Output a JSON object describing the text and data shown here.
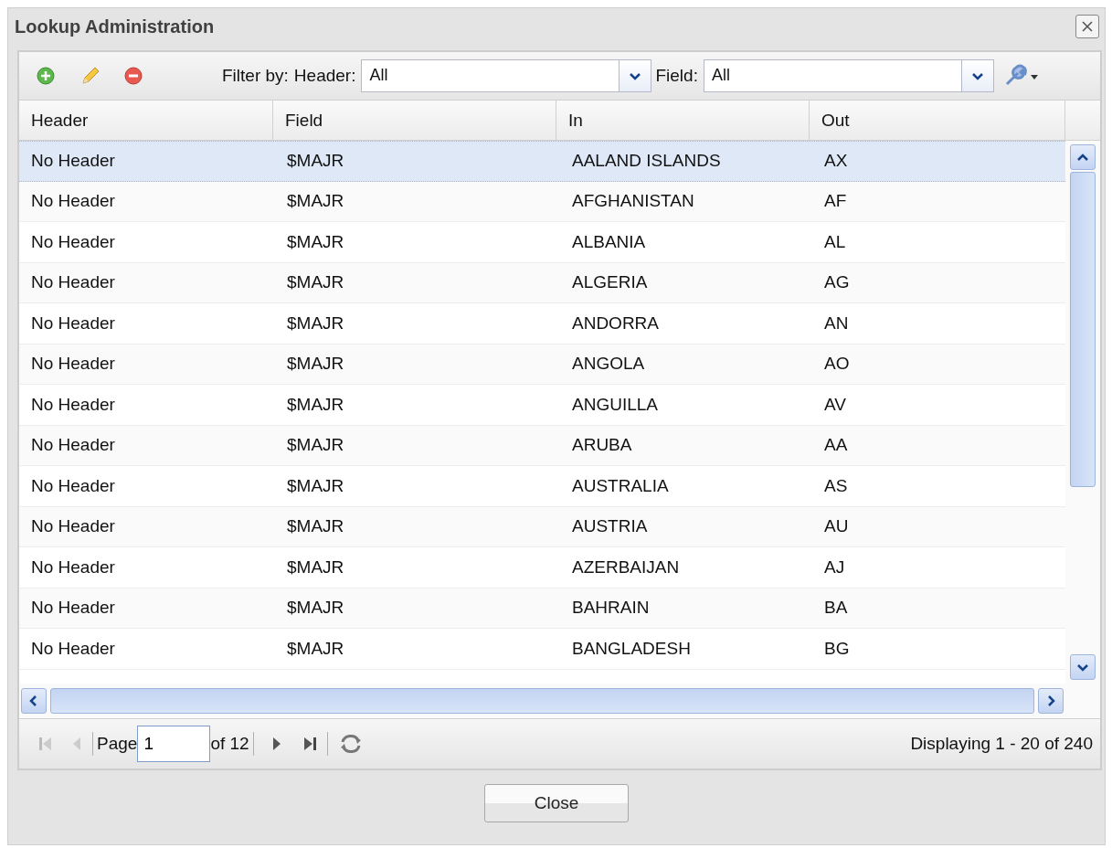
{
  "window": {
    "title": "Lookup Administration"
  },
  "toolbar": {
    "filter_label": "Filter by:",
    "header_label": "Header:",
    "header_value": "All",
    "field_label": "Field:",
    "field_value": "All"
  },
  "table": {
    "columns": [
      "Header",
      "Field",
      "In",
      "Out"
    ],
    "rows": [
      {
        "header": "No Header",
        "field": "$MAJR",
        "in": "AALAND ISLANDS",
        "out": "AX",
        "selected": true
      },
      {
        "header": "No Header",
        "field": "$MAJR",
        "in": "AFGHANISTAN",
        "out": "AF",
        "selected": false
      },
      {
        "header": "No Header",
        "field": "$MAJR",
        "in": "ALBANIA",
        "out": "AL",
        "selected": false
      },
      {
        "header": "No Header",
        "field": "$MAJR",
        "in": "ALGERIA",
        "out": "AG",
        "selected": false
      },
      {
        "header": "No Header",
        "field": "$MAJR",
        "in": "ANDORRA",
        "out": "AN",
        "selected": false
      },
      {
        "header": "No Header",
        "field": "$MAJR",
        "in": "ANGOLA",
        "out": "AO",
        "selected": false
      },
      {
        "header": "No Header",
        "field": "$MAJR",
        "in": "ANGUILLA",
        "out": "AV",
        "selected": false
      },
      {
        "header": "No Header",
        "field": "$MAJR",
        "in": "ARUBA",
        "out": "AA",
        "selected": false
      },
      {
        "header": "No Header",
        "field": "$MAJR",
        "in": "AUSTRALIA",
        "out": "AS",
        "selected": false
      },
      {
        "header": "No Header",
        "field": "$MAJR",
        "in": "AUSTRIA",
        "out": "AU",
        "selected": false
      },
      {
        "header": "No Header",
        "field": "$MAJR",
        "in": "AZERBAIJAN",
        "out": "AJ",
        "selected": false
      },
      {
        "header": "No Header",
        "field": "$MAJR",
        "in": "BAHRAIN",
        "out": "BA",
        "selected": false
      },
      {
        "header": "No Header",
        "field": "$MAJR",
        "in": "BANGLADESH",
        "out": "BG",
        "selected": false
      }
    ]
  },
  "pager": {
    "page_label": "Page",
    "page_value": "1",
    "of_label": "of 12",
    "display": "Displaying 1 - 20 of 240"
  },
  "buttons": [
    "Close"
  ]
}
